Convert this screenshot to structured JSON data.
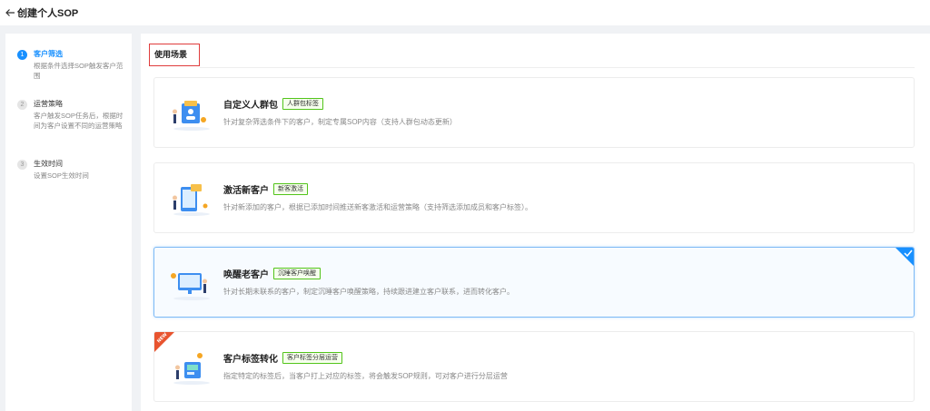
{
  "header": {
    "back_icon": "arrow-left-icon",
    "title": "创建个人SOP"
  },
  "steps": [
    {
      "number": "1",
      "title": "客户筛选",
      "desc": "根据条件选择SOP触发客户范围",
      "active": true
    },
    {
      "number": "2",
      "title": "运营策略",
      "desc": "客户触发SOP任务后，根据时间为客户设置不同的运营策略",
      "active": false
    },
    {
      "number": "3",
      "title": "生效时间",
      "desc": "设置SOP生效时间",
      "active": false
    }
  ],
  "main": {
    "section_title": "使用场景",
    "cards": [
      {
        "title": "自定义人群包",
        "tag": "人群包标签",
        "desc": "针对复杂筛选条件下的客户，制定专属SOP内容（支持人群包动态更新）",
        "icon": "crowd-package-icon",
        "selected": false,
        "is_new": false
      },
      {
        "title": "激活新客户",
        "tag": "新客激活",
        "desc": "针对新添加的客户，根据已添加时间推送新客激活和运营策略（支持筛选添加成员和客户标签）。",
        "icon": "activate-customer-icon",
        "selected": false,
        "is_new": false
      },
      {
        "title": "唤醒老客户",
        "tag": "沉睡客户唤醒",
        "desc": "针对长期未联系的客户，制定沉睡客户唤醒策略，持续跟进建立客户联系，进而转化客户。",
        "icon": "wake-customer-icon",
        "selected": true,
        "is_new": true
      },
      {
        "title": "客户标签转化",
        "tag": "客户标签分层运营",
        "desc": "指定特定的标签后，当客户打上对应的标签，将会触发SOP规则，可对客户进行分层运营",
        "icon": "tag-conversion-icon",
        "selected": false,
        "is_new": true,
        "ribbon_text": "NEW"
      }
    ]
  },
  "colors": {
    "accent": "#1890ff",
    "tag_border": "#52c41a",
    "highlight_box": "#e03c3c",
    "ribbon": "#e8542f"
  }
}
